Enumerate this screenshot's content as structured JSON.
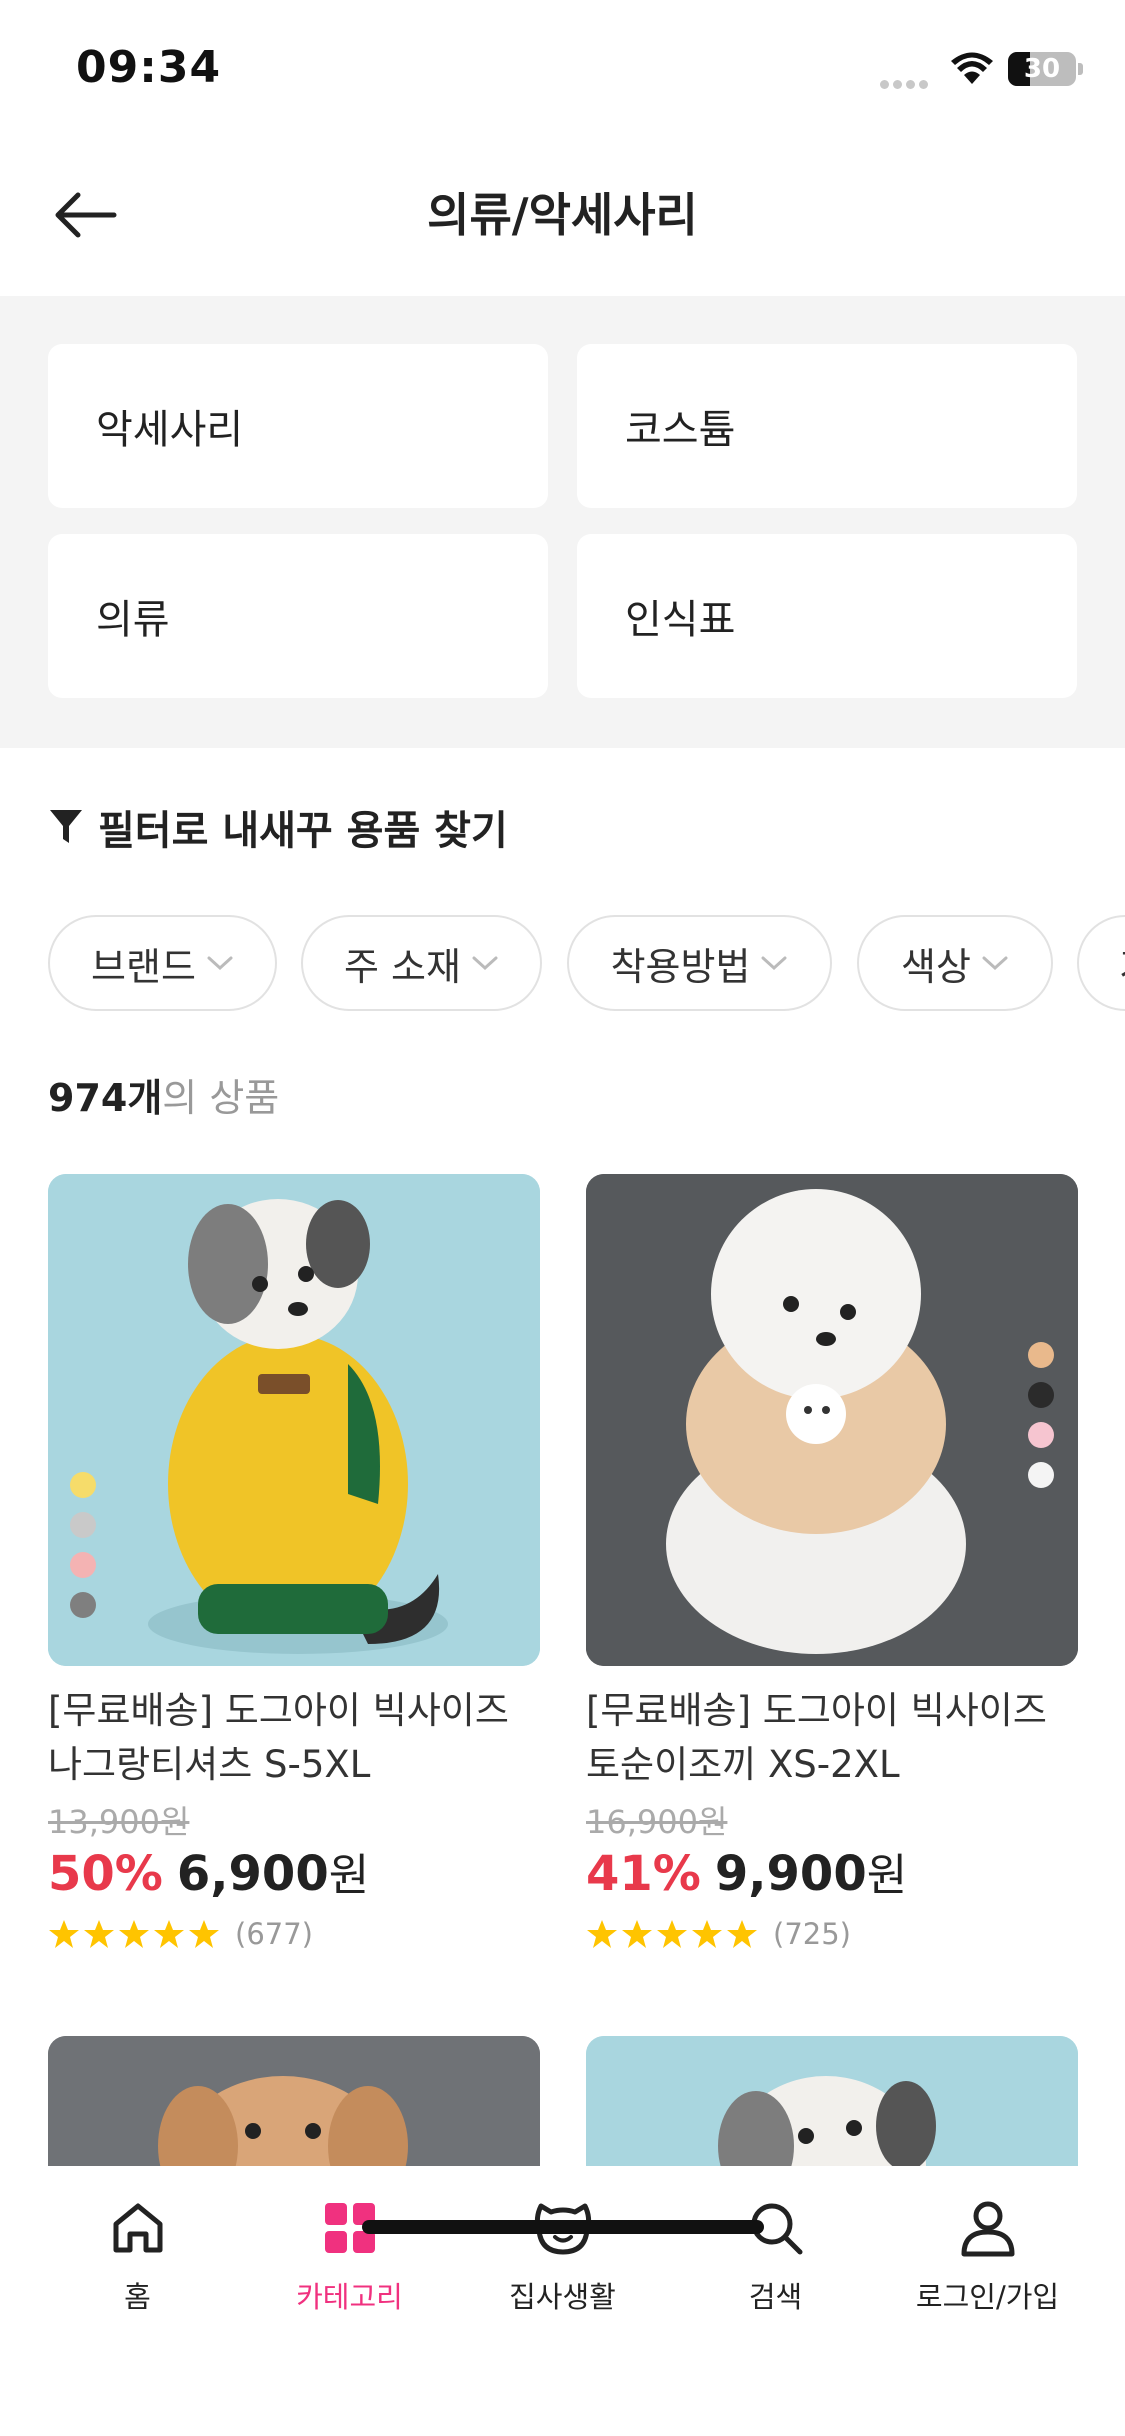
{
  "status_bar": {
    "time": "09:34",
    "battery": "30"
  },
  "header": {
    "title": "의류/악세사리",
    "back_icon": "arrow-left-icon"
  },
  "categories": [
    {
      "label": "악세사리"
    },
    {
      "label": "코스튬"
    },
    {
      "label": "의류"
    },
    {
      "label": "인식표"
    }
  ],
  "filter": {
    "title": "필터로 내새꾸 용품 찾기",
    "chips": [
      {
        "label": "브랜드"
      },
      {
        "label": "주 소재"
      },
      {
        "label": "착용방법"
      },
      {
        "label": "색상"
      },
      {
        "label": "기"
      }
    ]
  },
  "results": {
    "count": "974개",
    "suffix": "의 상품"
  },
  "products": [
    {
      "name": "[무료배송] 도그아이 빅사이즈 나그랑티셔츠 S-5XL",
      "original_price": "13,900원",
      "discount": "50%",
      "price": "6,900",
      "currency": "원",
      "rating": 5,
      "reviews": "(677)",
      "swatch_colors": [
        "#f6dc6a",
        "#c9c9c9",
        "#f4b3b3",
        "#7f7f7f"
      ]
    },
    {
      "name": "[무료배송] 도그아이 빅사이즈 토순이조끼 XS-2XL",
      "original_price": "16,900원",
      "discount": "41%",
      "price": "9,900",
      "currency": "원",
      "rating": 5,
      "reviews": "(725)",
      "swatch_colors": [
        "#e9b98c",
        "#2b2b2b",
        "#f6c5d0",
        "#f4f4f4"
      ]
    }
  ],
  "tabs": [
    {
      "label": "홈",
      "icon": "home-icon",
      "active": false
    },
    {
      "label": "카테고리",
      "icon": "category-grid-icon",
      "active": true
    },
    {
      "label": "집사생활",
      "icon": "pet-face-icon",
      "active": false
    },
    {
      "label": "검색",
      "icon": "search-icon",
      "active": false
    },
    {
      "label": "로그인/가입",
      "icon": "user-icon",
      "active": false
    }
  ],
  "colors": {
    "accent": "#f0317f",
    "discount": "#e8394b",
    "star": "#ffc400"
  }
}
